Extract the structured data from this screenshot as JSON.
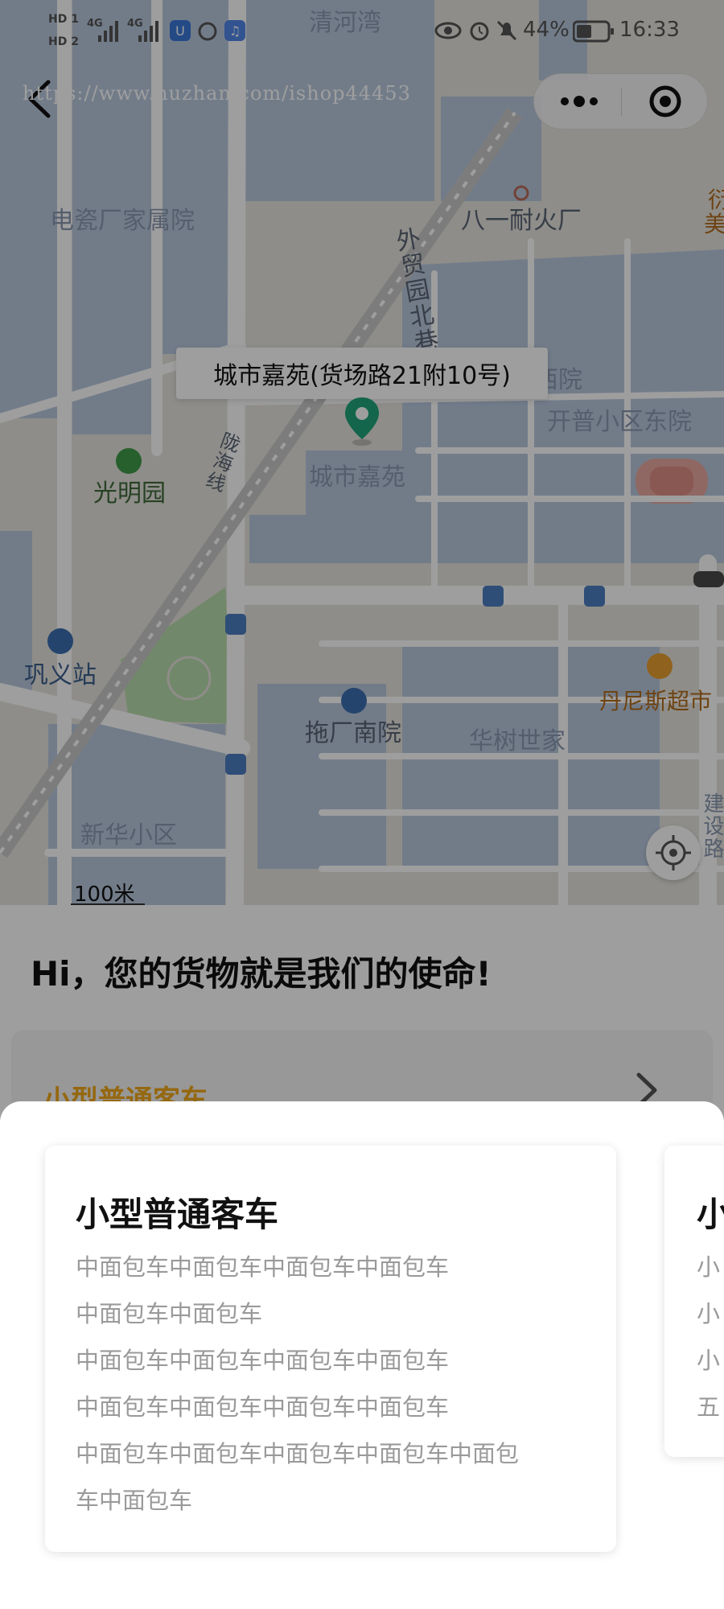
{
  "status_bar": {
    "network_badges": [
      "HD 1",
      "HD 2"
    ],
    "network_type_1": "4G",
    "network_type_2": "4G",
    "battery": "44%",
    "time": "16:33"
  },
  "nav": {
    "back_icon": "chevron-left-icon",
    "watermark": "https://www.huzhan.com/ishop44453",
    "more_icon": "more-dots-icon",
    "close_icon": "target-close-icon"
  },
  "map": {
    "marker_label": "城市嘉苑(货场路21附10号)",
    "scale_label": "100米",
    "labels": {
      "qinghewan": "清河湾",
      "diancichang": "电瓷厂家属院",
      "bayinaihuo": "八一耐火厂",
      "waimaoyuan": "外贸园北巷",
      "xiyuan": "西院",
      "kaipudong": "开普小区东院",
      "longhai": "陇海线",
      "guangmingyuan": "光明园",
      "chengshijiayuan": "城市嘉苑",
      "gongyizhan": "巩义站",
      "tuochangnanyuan": "拖厂南院",
      "huashushijia": "华树世家",
      "danisi": "丹尼斯超市",
      "xinhua": "新华小区",
      "jianshelu": "建设路",
      "mei": "美",
      "xing": "衍"
    }
  },
  "content": {
    "greeting": "Hi，您的货物就是我们的使命!",
    "peek_title": "小型普通客车"
  },
  "sheet": {
    "cards": [
      {
        "title": "小型普通客车",
        "lines": [
          "中面包车中面包车中面包车中面包车",
          "中面包车中面包车",
          "中面包车中面包车中面包车中面包车",
          "中面包车中面包车中面包车中面包车",
          "中面包车中面包车中面包车中面包车中面包",
          "车中面包车"
        ]
      },
      {
        "title": "小",
        "lines": [
          "小",
          "小",
          "小",
          "五"
        ]
      }
    ]
  },
  "colors": {
    "marker": "#1fa57a",
    "accent_orange": "#f0a81a",
    "map_block": "#b9c8de",
    "map_green": "#b8dcab"
  }
}
